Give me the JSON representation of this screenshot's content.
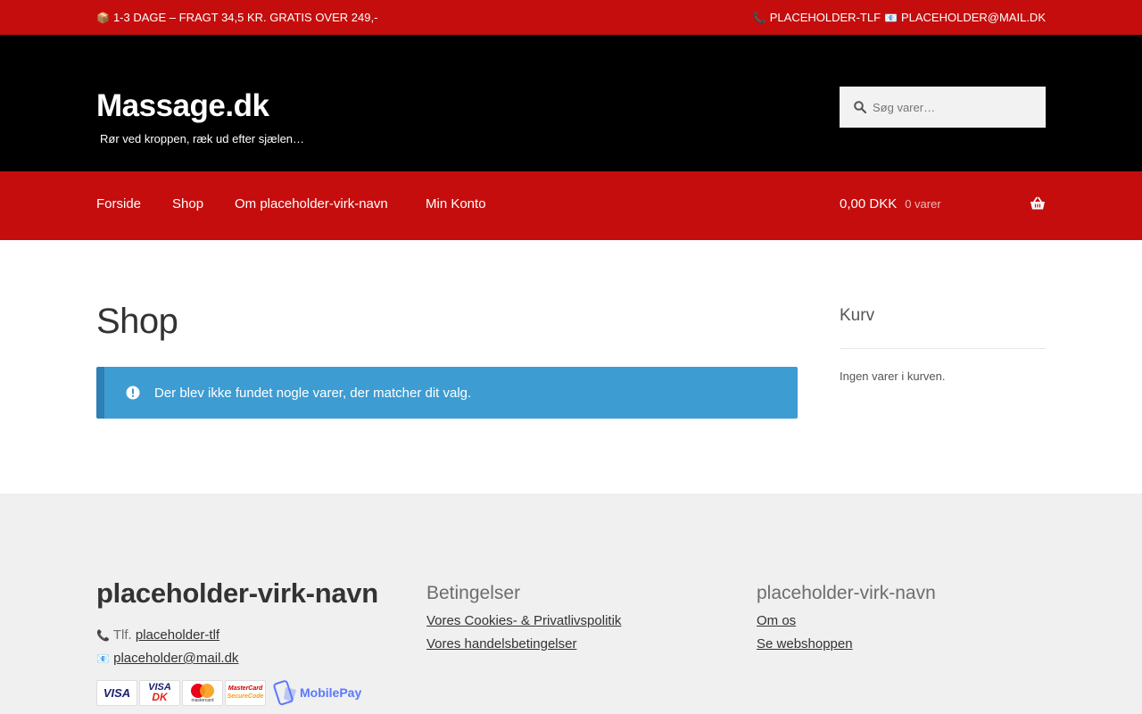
{
  "topbar": {
    "left_icon": "package-icon",
    "left_text": "1-3 DAGE – FRAGT 34,5 KR. GRATIS OVER 249,-",
    "phone_icon": "phone-icon",
    "phone_text": "PLACEHOLDER-TLF",
    "mail_icon": "mail-icon",
    "mail_text": "PLACEHOLDER@MAIL.DK"
  },
  "header": {
    "site_title": "Massage.dk",
    "tagline": "Rør ved kroppen, ræk ud efter sjælen…",
    "search_placeholder": "Søg varer…"
  },
  "nav": {
    "items": [
      {
        "label": "Forside"
      },
      {
        "label": "Shop"
      },
      {
        "label": "Om placeholder-virk-navn"
      },
      {
        "label": "Min Konto"
      }
    ],
    "cart_amount": "0,00 DKK",
    "cart_count": "0 varer"
  },
  "main": {
    "title": "Shop",
    "notice": "Der blev ikke fundet nogle varer, der matcher dit valg."
  },
  "sidebar": {
    "title": "Kurv",
    "empty_text": "Ingen varer i kurven."
  },
  "footer": {
    "col1": {
      "heading": "placeholder-virk-navn",
      "phone_label": "Tlf.",
      "phone_link": "placeholder-tlf",
      "email_link": "placeholder@mail.dk"
    },
    "col2": {
      "heading": "Betingelser",
      "links": [
        "Vores Cookies- & Privatlivspolitik",
        "Vores handelsbetingelser"
      ]
    },
    "col3": {
      "heading": "placeholder-virk-navn",
      "links": [
        "Om os",
        "Se webshoppen"
      ]
    },
    "payment": {
      "visa": "VISA",
      "visa_dk_top": "VISA",
      "visa_dk_bottom": "DK",
      "mastercard": "mastercard",
      "securecode_1": "MasterCard",
      "securecode_2": "SecureCode",
      "mobilepay": "MobilePay"
    }
  },
  "colors": {
    "brand_red": "#c50d0d",
    "header_black": "#000000",
    "notice_blue": "#3d9cd2",
    "footer_bg": "#f0f0f0"
  }
}
